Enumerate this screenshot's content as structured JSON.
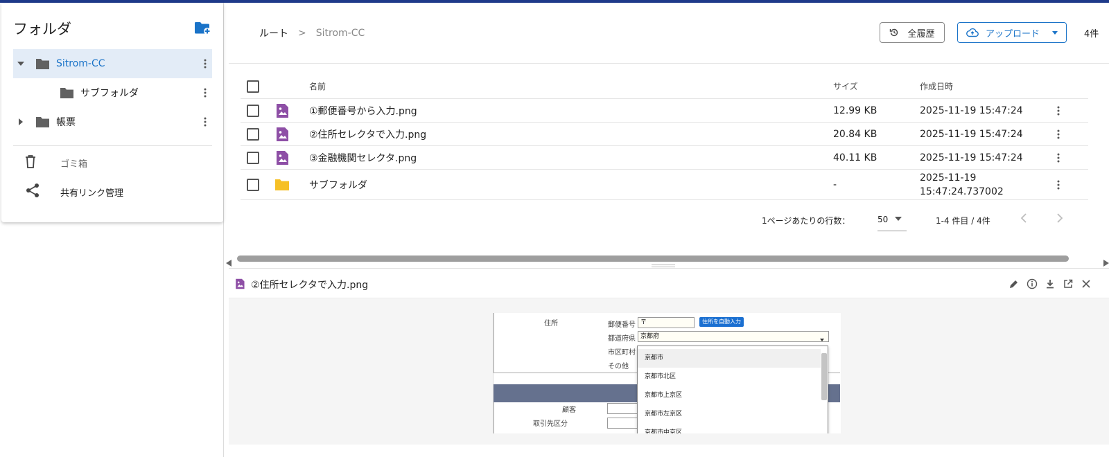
{
  "sidebar": {
    "title": "フォルダ",
    "tree": [
      {
        "label": "Sitrom-CC",
        "expanded": true,
        "selected": true
      },
      {
        "label": "サブフォルダ",
        "expanded": false,
        "selected": false
      },
      {
        "label": "帳票",
        "expanded": false,
        "selected": false
      }
    ],
    "trash_label": "ゴミ箱",
    "share_label": "共有リンク管理"
  },
  "header": {
    "breadcrumb_root": "ルート",
    "breadcrumb_sep": ">",
    "breadcrumb_current": "Sitrom-CC",
    "history_label": "全履歴",
    "upload_label": "アップロード",
    "count": "4件"
  },
  "table": {
    "columns": {
      "name": "名前",
      "size": "サイズ",
      "created": "作成日時"
    },
    "rows": [
      {
        "type": "image",
        "name": "①郵便番号から入力.png",
        "size": "12.99 KB",
        "created": "2025-11-19 15:47:24"
      },
      {
        "type": "image",
        "name": "②住所セレクタで入力.png",
        "size": "20.84 KB",
        "created": "2025-11-19 15:47:24"
      },
      {
        "type": "image",
        "name": "③金融機関セレクタ.png",
        "size": "40.11 KB",
        "created": "2025-11-19 15:47:24"
      },
      {
        "type": "folder",
        "name": "サブフォルダ",
        "size": "-",
        "created_line1": "2025-11-19",
        "created_line2": "15:47:24.737002"
      }
    ]
  },
  "pagination": {
    "rows_per_page_label": "1ページあたりの行数：",
    "rows_per_page": "50",
    "range": "1-4 件目 / 4件"
  },
  "preview": {
    "title": "②住所セレクタで入力.png",
    "image": {
      "address_label": "住所",
      "postal_label": "郵便番号",
      "postal_value": "〒",
      "auto_button": "住所を自動入力",
      "prefecture_label": "都道府県",
      "prefecture_value": "京都府",
      "city_label": "市区町村",
      "other_label": "その他",
      "customer_label": "顧客",
      "partner_label": "取引先区分",
      "options": [
        "京都市",
        "京都市北区",
        "京都市上京区",
        "京都市左京区",
        "京都市中京区"
      ]
    }
  },
  "colors": {
    "accent": "#1a73c8",
    "topbar": "#1e3a8a",
    "selected_bg": "#e3ecf7",
    "image_icon": "#8e4fa6",
    "folder_yellow": "#f6c026",
    "folder_gray": "#616161"
  }
}
